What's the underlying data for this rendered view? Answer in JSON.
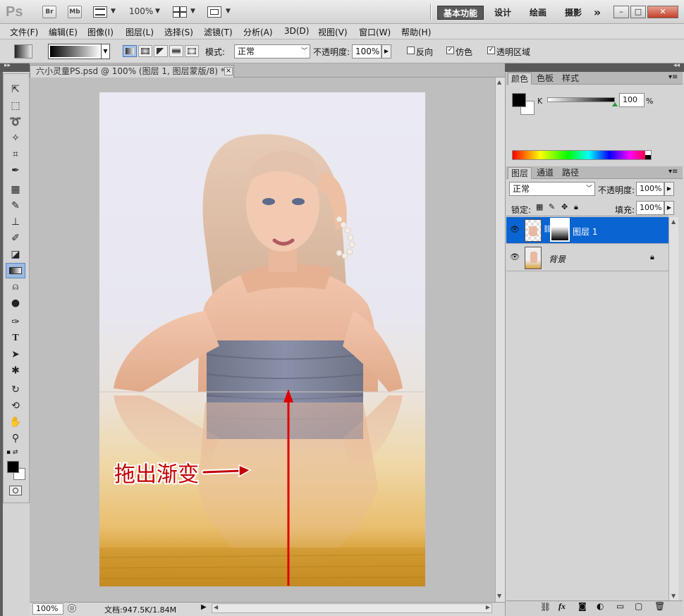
{
  "app": {
    "logo": "Ps",
    "bridge": "Br",
    "minibridge": "Mb",
    "zoom": "100%",
    "workspaces": [
      "基本功能",
      "设计",
      "绘画",
      "摄影"
    ],
    "more": "»",
    "window_buttons": [
      "–",
      "□",
      "✕"
    ]
  },
  "menu": [
    "文件(F)",
    "编辑(E)",
    "图像(I)",
    "图层(L)",
    "选择(S)",
    "滤镜(T)",
    "分析(A)",
    "3D(D)",
    "视图(V)",
    "窗口(W)",
    "帮助(H)"
  ],
  "options": {
    "mode_label": "模式:",
    "mode_value": "正常",
    "opacity_label": "不透明度:",
    "opacity_value": "100%",
    "reverse": "反向",
    "dither": "仿色",
    "transparency": "透明区域",
    "reverse_checked": false,
    "dither_checked": true,
    "transparency_checked": true
  },
  "document": {
    "tab_title": "六小灵童PS.psd @ 100% (图层 1, 图层蒙版/8) *",
    "close": "×",
    "annotation": "拖出渐变",
    "status_zoom": "100%",
    "status_doc": "文档:947.5K/1.84M"
  },
  "tools": [
    "move-tool",
    "marquee-tool",
    "lasso-tool",
    "quick-select-tool",
    "crop-tool",
    "eyedropper-tool",
    "healing-tool",
    "brush-tool",
    "clone-stamp-tool",
    "history-brush-tool",
    "eraser-tool",
    "gradient-tool",
    "blur-tool",
    "dodge-tool",
    "pen-tool",
    "type-tool",
    "path-select-tool",
    "shape-tool",
    "3d-rotate-tool",
    "3d-orbit-tool",
    "hand-tool",
    "zoom-tool"
  ],
  "color_panel": {
    "tabs": [
      "颜色",
      "色板",
      "样式"
    ],
    "channel": "K",
    "value": "100",
    "unit": "%"
  },
  "layers_panel": {
    "tabs": [
      "图层",
      "通道",
      "路径"
    ],
    "blend_mode": "正常",
    "opacity_label": "不透明度:",
    "opacity_value": "100%",
    "lock_label": "锁定:",
    "fill_label": "填充:",
    "fill_value": "100%",
    "layers": [
      {
        "name": "图层 1",
        "selected": true
      },
      {
        "name": "背景",
        "selected": false
      }
    ]
  },
  "colors": {
    "selection_blue": "#0a64d2",
    "arrow_red": "#e00000"
  }
}
